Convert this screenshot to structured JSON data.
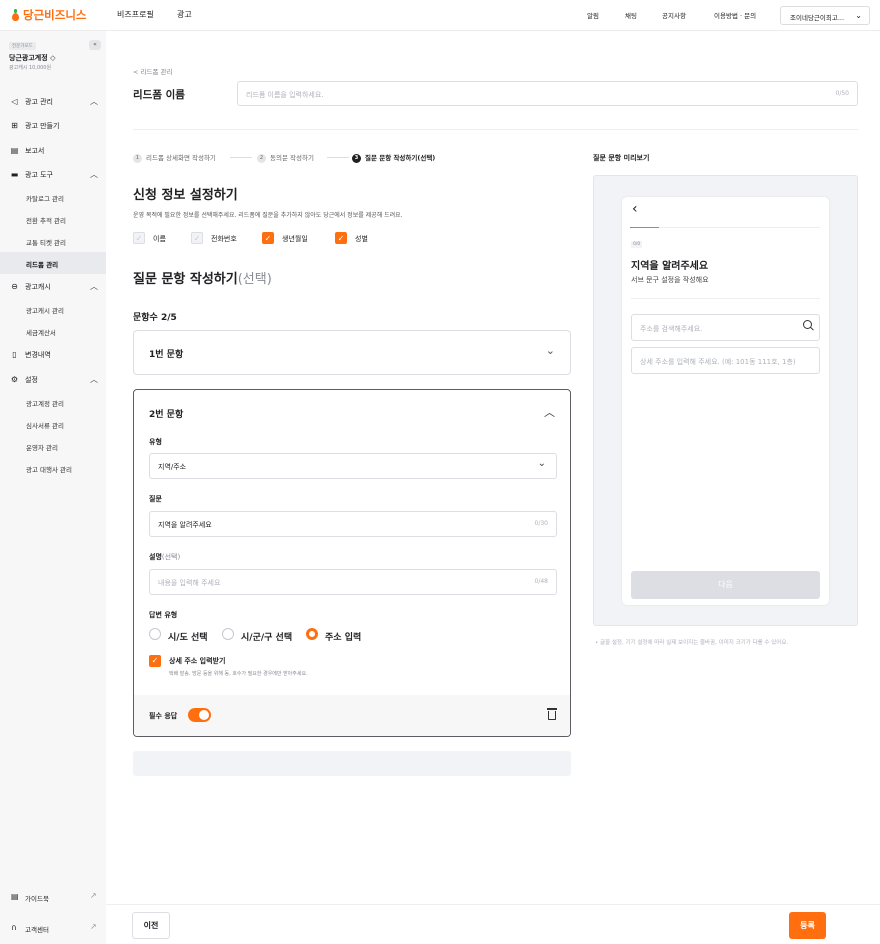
{
  "app": {
    "logo_text": "당근비즈니스",
    "brand_color": "#ff6f0f"
  },
  "topnav": {
    "biz_profile": "비즈프로필",
    "ads": "광고"
  },
  "topright": {
    "alerts": "알림",
    "chat": "채팅",
    "notice": "공지사항",
    "guide": "이용방법 · 문의",
    "account": "조이네당근이최고..."
  },
  "sidebar": {
    "account_label": "전문가모드",
    "account_name": "당근광고계정 ◇",
    "account_balance": "광고캐시 10,000원",
    "collapse": "«",
    "items": [
      {
        "label": "광고 관리",
        "icon": "megaphone-icon"
      },
      {
        "label": "광고 만들기",
        "icon": "plus-square-icon"
      },
      {
        "label": "보고서",
        "icon": "report-icon"
      },
      {
        "label": "광고 도구",
        "icon": "toolbox-icon"
      },
      {
        "label": "광고캐시",
        "icon": "coin-icon"
      },
      {
        "label": "변경내역",
        "icon": "document-icon"
      },
      {
        "label": "설정",
        "icon": "gear-icon"
      }
    ],
    "tools_sub": [
      "카탈로그 관리",
      "전환 추적 관리",
      "교통 티켓 관리",
      "리드폼 관리"
    ],
    "cash_sub": [
      "광고캐시 관리",
      "세금계산서"
    ],
    "settings_sub": [
      "광고계정 관리",
      "심사서류 관리",
      "운영자 관리",
      "광고 대행사 관리"
    ],
    "guidebook": "가이드북",
    "support": "고객센터"
  },
  "main": {
    "breadcrumb": "< 리드폼 관리",
    "form_name_label": "리드폼 이름",
    "form_name_placeholder": "리드폼 이름을 입력하세요.",
    "form_name_count": "0/50",
    "steps": [
      {
        "num": "1",
        "label": "리드폼 상세화면 작성하기"
      },
      {
        "num": "2",
        "label": "동의문 작성하기"
      },
      {
        "num": "3",
        "label": "질문 문항 작성하기(선택)"
      }
    ],
    "info_title": "신청 정보 설정하기",
    "info_desc": "운영 목적에 필요한 정보를 선택해주세요. 리드폼에 질문을 추가하지 않아도 당근에서 정보를 제공해 드려요.",
    "info_checks": [
      {
        "label": "이름",
        "checked": false
      },
      {
        "label": "전화번호",
        "checked": false
      },
      {
        "label": "생년월일",
        "checked": true
      },
      {
        "label": "성별",
        "checked": true
      }
    ],
    "questions_title": "질문 문항 작성하기",
    "questions_title_optional": "(선택)",
    "questions_count": "문항수 2/5",
    "q1_title": "1번 문항",
    "q2": {
      "title": "2번 문항",
      "type_label": "유형",
      "type_value": "지역/주소",
      "question_label": "질문",
      "question_value": "지역을 알려주세요",
      "question_count": "0/30",
      "desc_label": "설명",
      "desc_optional": "(선택)",
      "desc_placeholder": "내용을 입력해 주세요",
      "desc_count": "0/48",
      "answer_type_label": "답변 유형",
      "answer_options": [
        {
          "label": "시/도 선택",
          "selected": false
        },
        {
          "label": "시/군/구 선택",
          "selected": false
        },
        {
          "label": "주소 입력",
          "selected": true
        }
      ],
      "detail_label": "상세 주소 입력받기",
      "detail_desc": "택배 발송, 방문 등을 위해 동, 호수가 필요한 경우에만 받아주세요.",
      "required_label": "필수 응답",
      "required_on": true
    }
  },
  "preview": {
    "title": "질문 문항 미리보기",
    "page": "0/0",
    "heading": "지역을 알려주세요",
    "sub": "서브 문구 설정을 작성해요",
    "search_placeholder": "주소를 검색해주세요.",
    "detail_placeholder": "상세 주소를 입력해 주세요. (예: 101동 111호, 1층)",
    "next": "다음",
    "note": "• 글꼴 설정, 기기 설정에 따라 실제 보이지는 줄바꿈, 이미지 크기가 다를 수 있어요."
  },
  "footer": {
    "prev": "이전",
    "register": "등록"
  }
}
